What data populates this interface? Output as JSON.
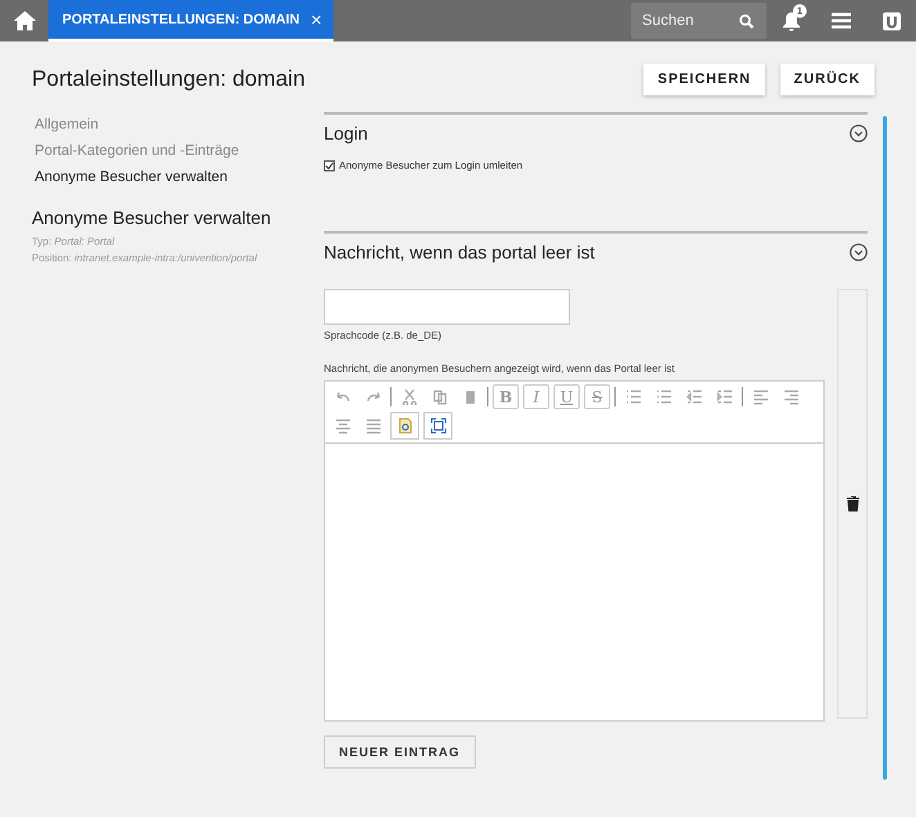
{
  "topbar": {
    "tab": {
      "label": "PORTALEINSTELLUNGEN: DOMAIN",
      "close": "×",
      "selected": true
    },
    "search": {
      "placeholder": "Suchen"
    },
    "notifications": "1"
  },
  "page": {
    "title": "Portaleinstellungen: domain",
    "buttons": [
      "SPEICHERN",
      "ZURÜCK"
    ]
  },
  "nav": [
    {
      "label": "Allgemein",
      "selected": false
    },
    {
      "label": "Portal-Kategorien und -Einträge",
      "selected": false
    },
    {
      "label": "Anonyme Besucher verwalten",
      "selected": true
    }
  ],
  "info": {
    "heading": "Anonyme Besucher verwalten",
    "type_label": "Typ:",
    "type_value": "Portal: Portal",
    "position_label": "Position:",
    "position_value": "intranet.example-intra:/univention/portal"
  },
  "sections": [
    {
      "title": "Login",
      "checkbox": {
        "label": "Anonyme Besucher zum Login umleiten",
        "checked": true
      }
    },
    {
      "title": "Nachricht, wenn das portal leer ist",
      "field_label": "Sprachcode (z.B. de_DE)",
      "editor_label": "Nachricht, die anonymen Besuchern angezeigt wird, wenn das Portal leer ist",
      "format_buttons": [
        "B",
        "I",
        "U",
        "S"
      ],
      "add_button": "NEUER EINTRAG"
    }
  ]
}
